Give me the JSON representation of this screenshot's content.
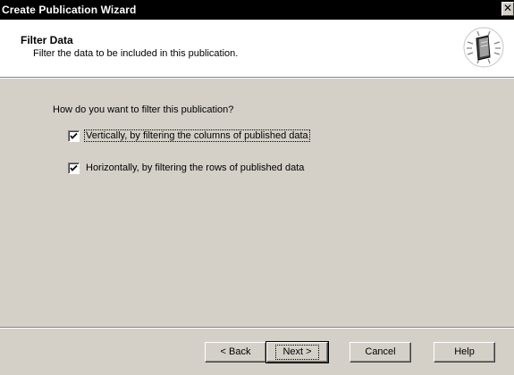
{
  "window": {
    "title": "Create Publication Wizard",
    "close_glyph": "✕"
  },
  "header": {
    "title": "Filter Data",
    "description": "Filter the data to be included in this publication.",
    "icon": "wizard-book-icon"
  },
  "body": {
    "question": "How do you want to filter this publication?",
    "options": [
      {
        "label": "Vertically, by filtering the columns of published data",
        "checked": true
      },
      {
        "label": "Horizontally, by filtering the rows of published data",
        "checked": true
      }
    ]
  },
  "buttons": {
    "back": "< Back",
    "next": "Next >",
    "cancel": "Cancel",
    "help": "Help"
  },
  "colors": {
    "dialog_bg": "#d4d0c8",
    "titlebar_bg": "#000000",
    "header_bg": "#ffffff"
  }
}
